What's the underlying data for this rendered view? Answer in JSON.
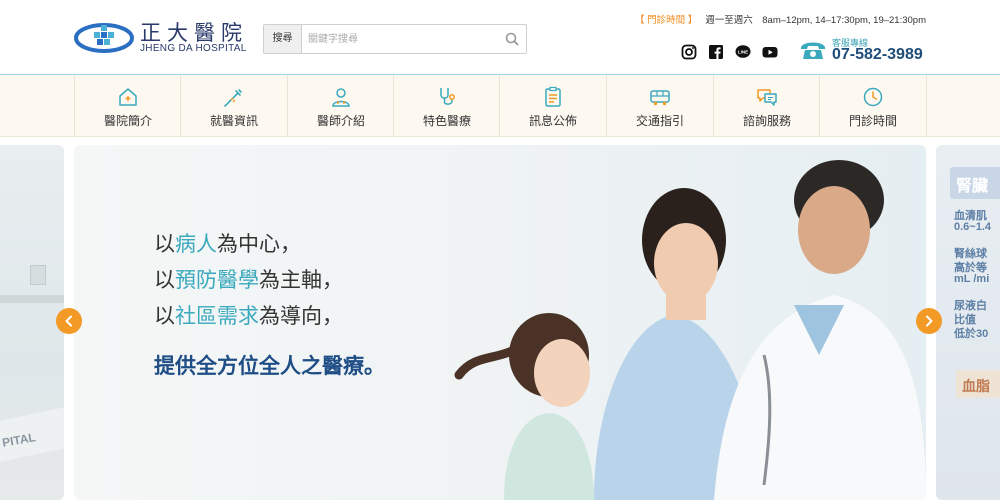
{
  "header": {
    "logo_cn": "正大醫院",
    "logo_en": "JHENG DA HOSPITAL",
    "search_label": "搜尋",
    "search_placeholder": "關鍵字搜尋",
    "hours_label": "【 門診時間 】",
    "hours_text": "週一至週六　8am–12pm, 14–17:30pm, 19–21:30pm",
    "phone_label": "客服專線",
    "phone_number": "07-582-3989",
    "social": [
      "instagram-icon",
      "facebook-icon",
      "line-icon",
      "youtube-icon"
    ]
  },
  "nav": [
    {
      "label": "醫院簡介",
      "icon": "home-icon"
    },
    {
      "label": "就醫資訊",
      "icon": "syringe-icon"
    },
    {
      "label": "醫師介紹",
      "icon": "doctor-icon"
    },
    {
      "label": "特色醫療",
      "icon": "stethoscope-icon"
    },
    {
      "label": "訊息公佈",
      "icon": "clipboard-icon"
    },
    {
      "label": "交通指引",
      "icon": "bus-icon"
    },
    {
      "label": "諮詢服務",
      "icon": "chat-icon"
    },
    {
      "label": "門診時間",
      "icon": "clock-icon"
    }
  ],
  "slide": {
    "line1_a": "以",
    "line1_hl": "病人",
    "line1_b": "為中心，",
    "line2_a": "以",
    "line2_hl": "預防醫學",
    "line2_b": "為主軸，",
    "line3_a": "以",
    "line3_hl": "社區需求",
    "line3_b": "為導向，",
    "lead": "提供全方位全人之醫療。"
  },
  "peek_right": {
    "title": "腎臟",
    "lines": [
      "血清肌",
      "0.6~1.4",
      "腎絲球",
      "高於等",
      "mL /mi",
      "尿液白",
      "比值",
      "低於30"
    ],
    "tag": "血脂"
  },
  "peek_left": {
    "text": "PITAL"
  },
  "colors": {
    "accent": "#3aa9bd",
    "brand_navy": "#1f4d86",
    "arrow": "#f29a25",
    "hours_highlight": "#f08a1c"
  }
}
